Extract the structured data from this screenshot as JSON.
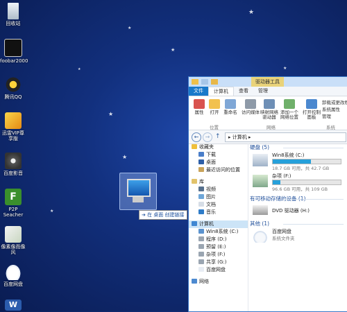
{
  "desktop": {
    "icons": [
      {
        "label": "回收站"
      },
      {
        "label": "foobar2000"
      },
      {
        "label": "腾讯QQ"
      },
      {
        "label": "迅雷VIP尊享版"
      },
      {
        "label": "百度影音"
      },
      {
        "label": "P2P Seacher"
      },
      {
        "label": "像素像而像风"
      },
      {
        "label": "百度网盘"
      }
    ],
    "drag_tooltip": "➔ 在 桌面 创建链接"
  },
  "explorer": {
    "context_tab": "驱动器工具",
    "tabs": [
      "文件",
      "计算机",
      "查看",
      "管理"
    ],
    "ribbon": {
      "buttons": [
        "属性",
        "打开",
        "重命名",
        "访问媒体",
        "映射网络驱动器",
        "添加一个网络位置",
        "打开控制面板"
      ],
      "right_items": [
        "卸载或更改程序",
        "系统属性",
        "管理"
      ],
      "groups": [
        "位置",
        "网络",
        "系统"
      ]
    },
    "address": "▸ 计算机 ▸",
    "nav": [
      {
        "label": "收藏夹"
      },
      {
        "label": "下载"
      },
      {
        "label": "桌面"
      },
      {
        "label": "最近访问的位置"
      },
      {
        "label": "库"
      },
      {
        "label": "视频"
      },
      {
        "label": "图片"
      },
      {
        "label": "文档"
      },
      {
        "label": "音乐"
      },
      {
        "label": "计算机"
      },
      {
        "label": "Win8系统 (C:)"
      },
      {
        "label": "程序 (D:)"
      },
      {
        "label": "预留 (E:)"
      },
      {
        "label": "杂项 (F:)"
      },
      {
        "label": "共享 (G:)"
      },
      {
        "label": "百度网盘"
      },
      {
        "label": "网络"
      }
    ],
    "sections": {
      "hdd": "硬盘 (5)",
      "removable": "有可移动存储的设备 (1)",
      "other": "其他 (1)"
    },
    "drives": [
      {
        "name": "Win8系统 (C:)",
        "size": "18.7 GB 可用，共 42.7 GB",
        "used_fraction": 0.56
      },
      {
        "name": "杂项 (F:)",
        "size": "96.6 GB 可用，共 109 GB",
        "used_fraction": 0.11
      }
    ],
    "dvd": "DVD 驱动器 (H:)",
    "other_item": {
      "name": "百度网盘",
      "sub": "系统文件夹"
    }
  },
  "colors": {
    "accent": "#1979ca",
    "context": "#e9d37a",
    "bar": "#26a0da"
  }
}
